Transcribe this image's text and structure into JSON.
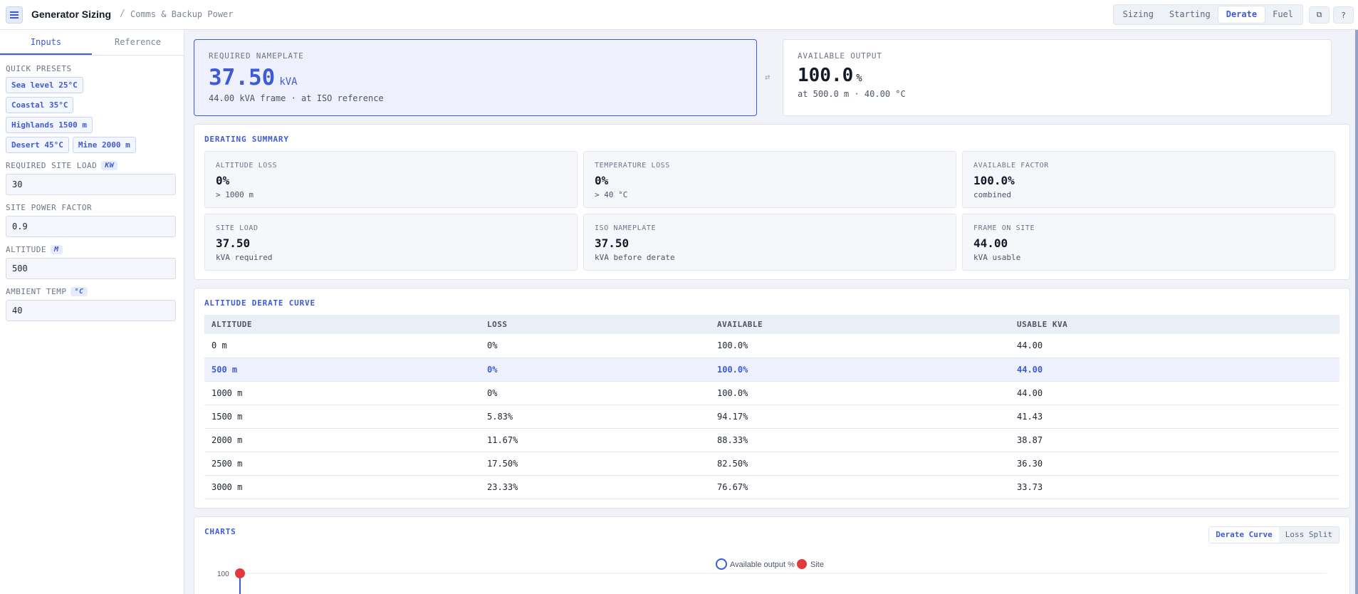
{
  "header": {
    "title": "Generator Sizing",
    "separator": "/",
    "subtitle": "Comms & Backup Power",
    "tabs": [
      "Sizing",
      "Starting",
      "Derate",
      "Fuel"
    ],
    "active_tab": "Derate"
  },
  "sidebar": {
    "tabs": [
      "Inputs",
      "Reference"
    ],
    "quick_presets_label": "QUICK PRESETS",
    "presets": [
      "Sea level 25°C",
      "Coastal 35°C",
      "Highlands 1500 m",
      "Desert 45°C",
      "Mine 2000 m"
    ],
    "fields": [
      {
        "label": "REQUIRED SITE LOAD",
        "unit": "KW",
        "value": "30"
      },
      {
        "label": "SITE POWER FACTOR",
        "unit": "",
        "value": "0.9"
      },
      {
        "label": "ALTITUDE",
        "unit": "M",
        "value": "500"
      },
      {
        "label": "AMBIENT TEMP",
        "unit": "°C",
        "value": "40"
      }
    ]
  },
  "hero": {
    "required": {
      "label": "REQUIRED NAMEPLATE",
      "value": "37.50",
      "unit": "kVA",
      "sub": "44.00 kVA frame · at ISO reference"
    },
    "available": {
      "label": "AVAILABLE OUTPUT",
      "value": "100.0",
      "unit": "%",
      "sub": "at 500.0 m · 40.00 °C"
    }
  },
  "summary": {
    "title": "DERATING SUMMARY",
    "stats": [
      {
        "label": "ALTITUDE LOSS",
        "value": "0%",
        "sub": "> 1000 m"
      },
      {
        "label": "TEMPERATURE LOSS",
        "value": "0%",
        "sub": "> 40 °C"
      },
      {
        "label": "AVAILABLE FACTOR",
        "value": "100.0%",
        "sub": "combined"
      },
      {
        "label": "SITE LOAD",
        "value": "37.50",
        "sub": "kVA required"
      },
      {
        "label": "ISO NAMEPLATE",
        "value": "37.50",
        "sub": "kVA before derate"
      },
      {
        "label": "FRAME ON SITE",
        "value": "44.00",
        "sub": "kVA usable"
      }
    ]
  },
  "curve": {
    "title": "ALTITUDE DERATE CURVE",
    "columns": [
      "ALTITUDE",
      "LOSS",
      "AVAILABLE",
      "USABLE KVA"
    ],
    "rows": [
      [
        "0 m",
        "0%",
        "100.0%",
        "44.00"
      ],
      [
        "500 m",
        "0%",
        "100.0%",
        "44.00"
      ],
      [
        "1000 m",
        "0%",
        "100.0%",
        "44.00"
      ],
      [
        "1500 m",
        "5.83%",
        "94.17%",
        "41.43"
      ],
      [
        "2000 m",
        "11.67%",
        "88.33%",
        "38.87"
      ],
      [
        "2500 m",
        "17.50%",
        "82.50%",
        "36.30"
      ],
      [
        "3000 m",
        "23.33%",
        "76.67%",
        "33.73"
      ]
    ],
    "highlight_row": 1
  },
  "charts": {
    "title": "CHARTS",
    "toggle": [
      "Derate Curve",
      "Loss Split"
    ],
    "active": "Derate Curve",
    "legend": [
      "Available output %",
      "Site"
    ],
    "y_tick": "100",
    "colors": {
      "line": "#3d5bd9",
      "site": "#e03a3e"
    }
  }
}
